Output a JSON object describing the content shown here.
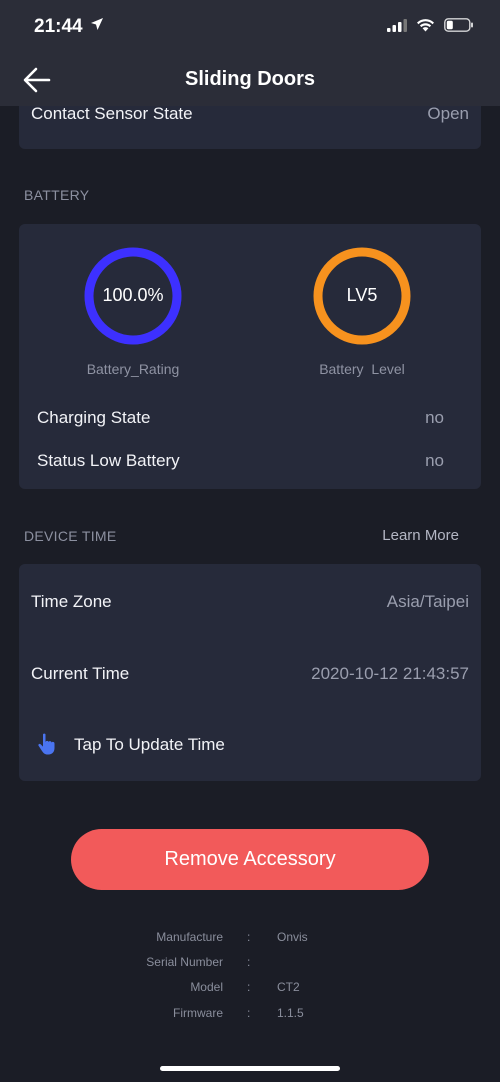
{
  "status_bar": {
    "time": "21:44"
  },
  "header": {
    "title": "Sliding Doors"
  },
  "contact": {
    "label": "Contact Sensor State",
    "value": "Open"
  },
  "battery": {
    "section_title": "BATTERY",
    "rating": {
      "value_text": "100.0%",
      "label": "Battery_Rating",
      "percent": 100,
      "color": "#3d30ff"
    },
    "level": {
      "value_text": "LV5",
      "label": "Battery  Level",
      "color": "#f7921e"
    },
    "rows": [
      {
        "label": "Charging State",
        "value": "no"
      },
      {
        "label": "Status Low Battery",
        "value": "no"
      }
    ]
  },
  "device_time": {
    "section_title": "DEVICE TIME",
    "learn_more": "Learn More",
    "time_zone_label": "Time Zone",
    "time_zone_value": "Asia/Taipei",
    "current_time_label": "Current Time",
    "current_time_value": "2020-10-12 21:43:57",
    "tap_update_label": "Tap To Update Time"
  },
  "actions": {
    "remove_label": "Remove Accessory",
    "remove_color": "#f25a5a"
  },
  "info": [
    {
      "label": "Manufacture",
      "value": "Onvis"
    },
    {
      "label": "Serial Number",
      "value": ""
    },
    {
      "label": "Model",
      "value": "CT2"
    },
    {
      "label": "Firmware",
      "value": "1.1.5"
    }
  ],
  "icons": {
    "back": "arrow-left-icon",
    "tap": "hand-pointer-icon",
    "signal": "cellular-signal-icon",
    "wifi": "wifi-icon",
    "battery": "battery-icon",
    "location": "location-arrow-icon"
  }
}
